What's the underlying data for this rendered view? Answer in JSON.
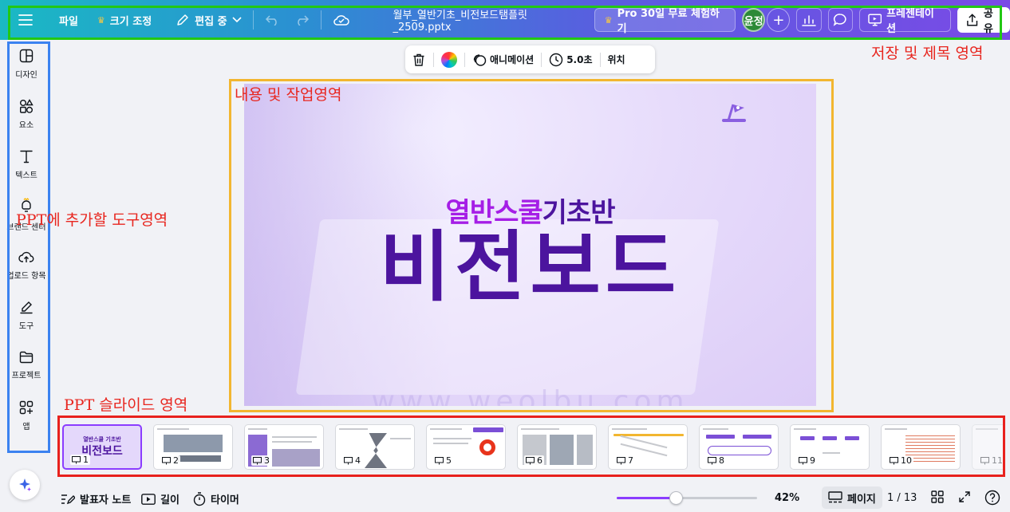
{
  "topbar": {
    "menu_icon": "hamburger-icon",
    "file_label": "파일",
    "resize_label": "크기 조정",
    "resize_icon": "crown-icon",
    "edit_label": "편집 중",
    "edit_icon": "pencil-icon",
    "filename": "월부_열반기초_비전보드탬플릿_2509.pptx",
    "pro_label": "Pro 30일 무료 체험하기",
    "avatar_text": "윤정",
    "present_label": "프레젠테이션",
    "share_label": "공유"
  },
  "sidebar": {
    "items": [
      {
        "label": "디자인",
        "icon": "layout-icon"
      },
      {
        "label": "요소",
        "icon": "elements-icon"
      },
      {
        "label": "텍스트",
        "icon": "text-icon"
      },
      {
        "label": "브랜드 센터",
        "icon": "brand-icon"
      },
      {
        "label": "업로드 항목",
        "icon": "upload-cloud-icon"
      },
      {
        "label": "도구",
        "icon": "draw-icon"
      },
      {
        "label": "프로젝트",
        "icon": "folder-icon"
      },
      {
        "label": "앱",
        "icon": "apps-icon"
      }
    ]
  },
  "float_toolbar": {
    "animation_label": "애니메이션",
    "time_label": "5.0초",
    "position_label": "위치"
  },
  "slide": {
    "subtitle_part1": "열반스쿨",
    "subtitle_part2": "기초반",
    "title": "비전보드",
    "watermark": "www.weolbu.com"
  },
  "annotations": {
    "top_right": "저장 및 제목 영역",
    "content": "내용 및 작업영역",
    "tools": "PPT에 추가할 도구영역",
    "slides": "PPT 슬라이드 영역",
    "colors": {
      "green": "#22c814",
      "orange": "#f2b630",
      "blue": "#3b82f0",
      "red": "#e8211d"
    }
  },
  "thumbnails": {
    "numbers": [
      "1",
      "2",
      "3",
      "4",
      "5",
      "6",
      "7",
      "8",
      "9",
      "10",
      "11"
    ],
    "first_title": "비전보드",
    "first_subtitle": "열반스쿨 기초반"
  },
  "bottom": {
    "notes_label": "발표자 노트",
    "duration_label": "길이",
    "timer_label": "타이머",
    "zoom_value": 42,
    "zoom_label": "42%",
    "pages_label": "페이지",
    "page_count": "1 / 13"
  },
  "colors": {
    "accent": "#8b3dff",
    "slide_purple": "#4c149e"
  }
}
